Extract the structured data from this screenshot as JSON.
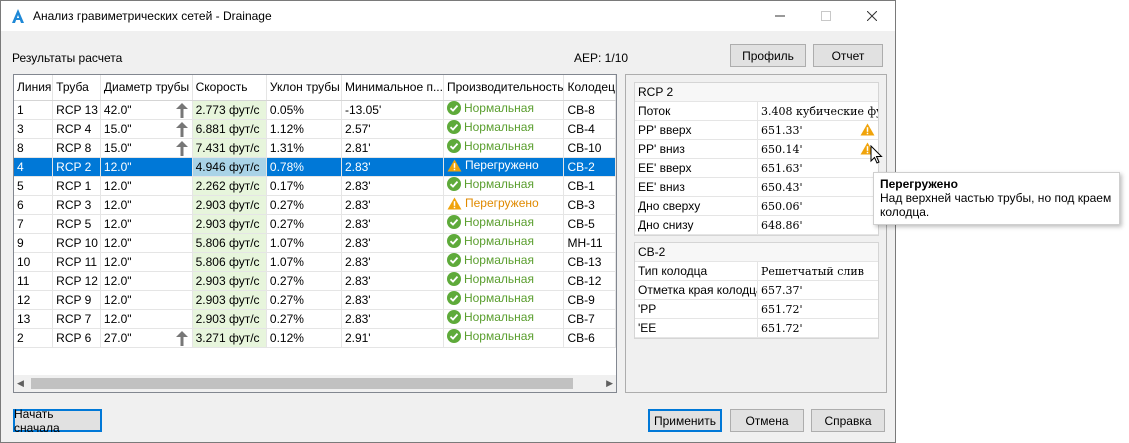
{
  "window": {
    "title": "Анализ гравиметрических сетей - Drainage"
  },
  "header": {
    "results_label": "Результаты расчета",
    "aep": "AEP: 1/10",
    "profile_button": "Профиль",
    "report_button": "Отчет"
  },
  "table": {
    "columns": [
      "Линия",
      "Труба",
      "Диаметр трубы",
      "Скорость",
      "Уклон трубы",
      "Минимальное п...",
      "Производительность",
      "Колодец"
    ],
    "rows": [
      {
        "line": "1",
        "pipe": "RCP 13",
        "diameter": "42.0\"",
        "velocity": "2.773 фут/с",
        "slope": "0.05%",
        "min": "-13.05'",
        "status": "Нормальная",
        "status_type": "ok",
        "structure": "CB-8",
        "arrow": true
      },
      {
        "line": "3",
        "pipe": "RCP 4",
        "diameter": "15.0\"",
        "velocity": "6.881 фут/с",
        "slope": "1.12%",
        "min": "2.57'",
        "status": "Нормальная",
        "status_type": "ok",
        "structure": "CB-4",
        "arrow": true
      },
      {
        "line": "8",
        "pipe": "RCP 8",
        "diameter": "15.0\"",
        "velocity": "7.431 фут/с",
        "slope": "1.31%",
        "min": "2.81'",
        "status": "Нормальная",
        "status_type": "ok",
        "structure": "CB-10",
        "arrow": true
      },
      {
        "line": "4",
        "pipe": "RCP 2",
        "diameter": "12.0\"",
        "velocity": "4.946 фут/с",
        "slope": "0.78%",
        "min": "2.83'",
        "status": "Перегружено",
        "status_type": "warn",
        "structure": "CB-2",
        "arrow": false,
        "selected": true
      },
      {
        "line": "5",
        "pipe": "RCP 1",
        "diameter": "12.0\"",
        "velocity": "2.262 фут/с",
        "slope": "0.17%",
        "min": "2.83'",
        "status": "Нормальная",
        "status_type": "ok",
        "structure": "CB-1",
        "arrow": false
      },
      {
        "line": "6",
        "pipe": "RCP 3",
        "diameter": "12.0\"",
        "velocity": "2.903 фут/с",
        "slope": "0.27%",
        "min": "2.83'",
        "status": "Перегружено",
        "status_type": "warn",
        "structure": "CB-3",
        "arrow": false
      },
      {
        "line": "7",
        "pipe": "RCP 5",
        "diameter": "12.0\"",
        "velocity": "2.903 фут/с",
        "slope": "0.27%",
        "min": "2.83'",
        "status": "Нормальная",
        "status_type": "ok",
        "structure": "CB-5",
        "arrow": false
      },
      {
        "line": "9",
        "pipe": "RCP 10",
        "diameter": "12.0\"",
        "velocity": "5.806 фут/с",
        "slope": "1.07%",
        "min": "2.83'",
        "status": "Нормальная",
        "status_type": "ok",
        "structure": "MH-11",
        "arrow": false
      },
      {
        "line": "10",
        "pipe": "RCP 11",
        "diameter": "12.0\"",
        "velocity": "5.806 фут/с",
        "slope": "1.07%",
        "min": "2.83'",
        "status": "Нормальная",
        "status_type": "ok",
        "structure": "CB-13",
        "arrow": false
      },
      {
        "line": "11",
        "pipe": "RCP 12",
        "diameter": "12.0\"",
        "velocity": "2.903 фут/с",
        "slope": "0.27%",
        "min": "2.83'",
        "status": "Нормальная",
        "status_type": "ok",
        "structure": "CB-12",
        "arrow": false
      },
      {
        "line": "12",
        "pipe": "RCP 9",
        "diameter": "12.0\"",
        "velocity": "2.903 фут/с",
        "slope": "0.27%",
        "min": "2.83'",
        "status": "Нормальная",
        "status_type": "ok",
        "structure": "CB-9",
        "arrow": false
      },
      {
        "line": "13",
        "pipe": "RCP 7",
        "diameter": "12.0\"",
        "velocity": "2.903 фут/с",
        "slope": "0.27%",
        "min": "2.83'",
        "status": "Нормальная",
        "status_type": "ok",
        "structure": "CB-7",
        "arrow": false
      },
      {
        "line": "2",
        "pipe": "RCP 6",
        "diameter": "27.0\"",
        "velocity": "3.271 фут/с",
        "slope": "0.12%",
        "min": "2.91'",
        "status": "Нормальная",
        "status_type": "ok",
        "structure": "CB-6",
        "arrow": true
      }
    ]
  },
  "pipe_props": {
    "title": "RCP 2",
    "rows": [
      {
        "key": "Поток",
        "value": "3.408 кубические фу...",
        "warn": false
      },
      {
        "key": "PP' вверх",
        "value": "651.33'",
        "warn": true
      },
      {
        "key": "PP' вниз",
        "value": "650.14'",
        "warn": true
      },
      {
        "key": "EE' вверх",
        "value": "651.63'",
        "warn": false
      },
      {
        "key": "EE' вниз",
        "value": "650.43'",
        "warn": false
      },
      {
        "key": "Дно сверху",
        "value": "650.06'",
        "warn": false
      },
      {
        "key": "Дно снизу",
        "value": "648.86'",
        "warn": false
      }
    ]
  },
  "structure_props": {
    "title": "CB-2",
    "rows": [
      {
        "key": "Тип колодца",
        "value": "Решетчатый слив"
      },
      {
        "key": "Отметка края колодца",
        "value": "657.37'"
      },
      {
        "key": "'PP",
        "value": "651.72'"
      },
      {
        "key": "'EE",
        "value": "651.72'"
      }
    ]
  },
  "tooltip": {
    "title": "Перегружено",
    "text": "Над верхней частью трубы, но под краем колодца."
  },
  "footer": {
    "restart_button": "Начать сначала",
    "apply_button": "Применить",
    "cancel_button": "Отмена",
    "help_button": "Справка"
  },
  "colors": {
    "ok": "#5eaa3a",
    "warn": "#f0a30a",
    "selection": "#0078d7",
    "velocity_bg": "#e7f5dc"
  }
}
